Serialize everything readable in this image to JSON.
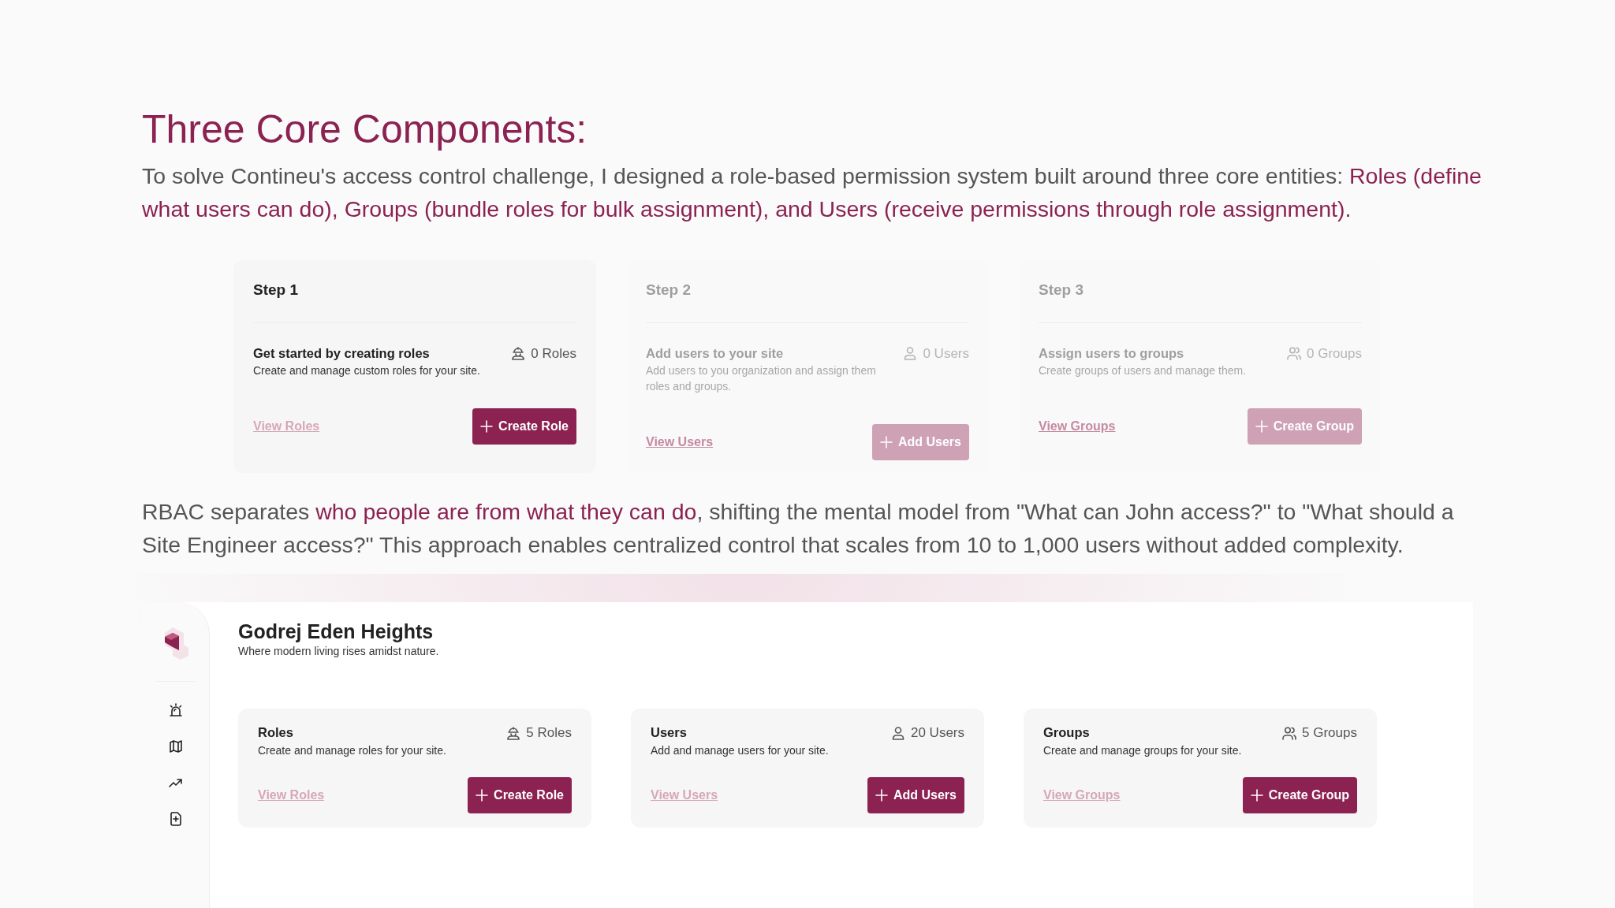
{
  "heading": "Three Core Components:",
  "intro": [
    {
      "text": "To solve Contineu's access control challenge, I designed a role-based permission system built around three core entities: ",
      "highlight": false
    },
    {
      "text": "Roles (define what users can do), Groups (bundle roles for bulk assignment), and Users (receive permissions through role assignment).",
      "highlight": true
    }
  ],
  "steps": [
    {
      "label": "Step 1",
      "title": "Get started by creating roles",
      "description": "Create and manage custom roles for your site.",
      "kind": "role",
      "count": "0 Roles",
      "link": "View Roles",
      "button": "Create Role",
      "disabled": false
    },
    {
      "label": "Step 2",
      "title": "Add users to your site",
      "description": "Add users to you organization and assign them roles and groups.",
      "kind": "user",
      "count": "0 Users",
      "link": "View Users",
      "button": "Add Users",
      "disabled": true
    },
    {
      "label": "Step 3",
      "title": "Assign users to groups",
      "description": "Create groups of users and manage them.",
      "kind": "group",
      "count": "0 Groups",
      "link": "View Groups",
      "button": "Create Group",
      "disabled": true
    }
  ],
  "summary": [
    {
      "text": "RBAC separates ",
      "highlight": false
    },
    {
      "text": "who people are from what they can do",
      "highlight": true
    },
    {
      "text": ", shifting the mental model from \"What can John access?\" to \"What should a Site Engineer access?\" This approach enables centralized control that scales from 10 to 1,000 users without added complexity.",
      "highlight": false
    }
  ],
  "app": {
    "title": "Godrej Eden Heights",
    "subtitle": "Where modern living rises amidst nature.",
    "cards": [
      {
        "title": "Roles",
        "description": "Create and manage roles for your site.",
        "kind": "role",
        "count": "5 Roles",
        "link": "View Roles",
        "button": "Create Role"
      },
      {
        "title": "Users",
        "description": "Add and manage users for your site.",
        "kind": "user",
        "count": "20 Users",
        "link": "View Users",
        "button": "Add Users"
      },
      {
        "title": "Groups",
        "description": "Create and manage groups for your site.",
        "kind": "group",
        "count": "5 Groups",
        "link": "View Groups",
        "button": "Create Group"
      }
    ]
  }
}
